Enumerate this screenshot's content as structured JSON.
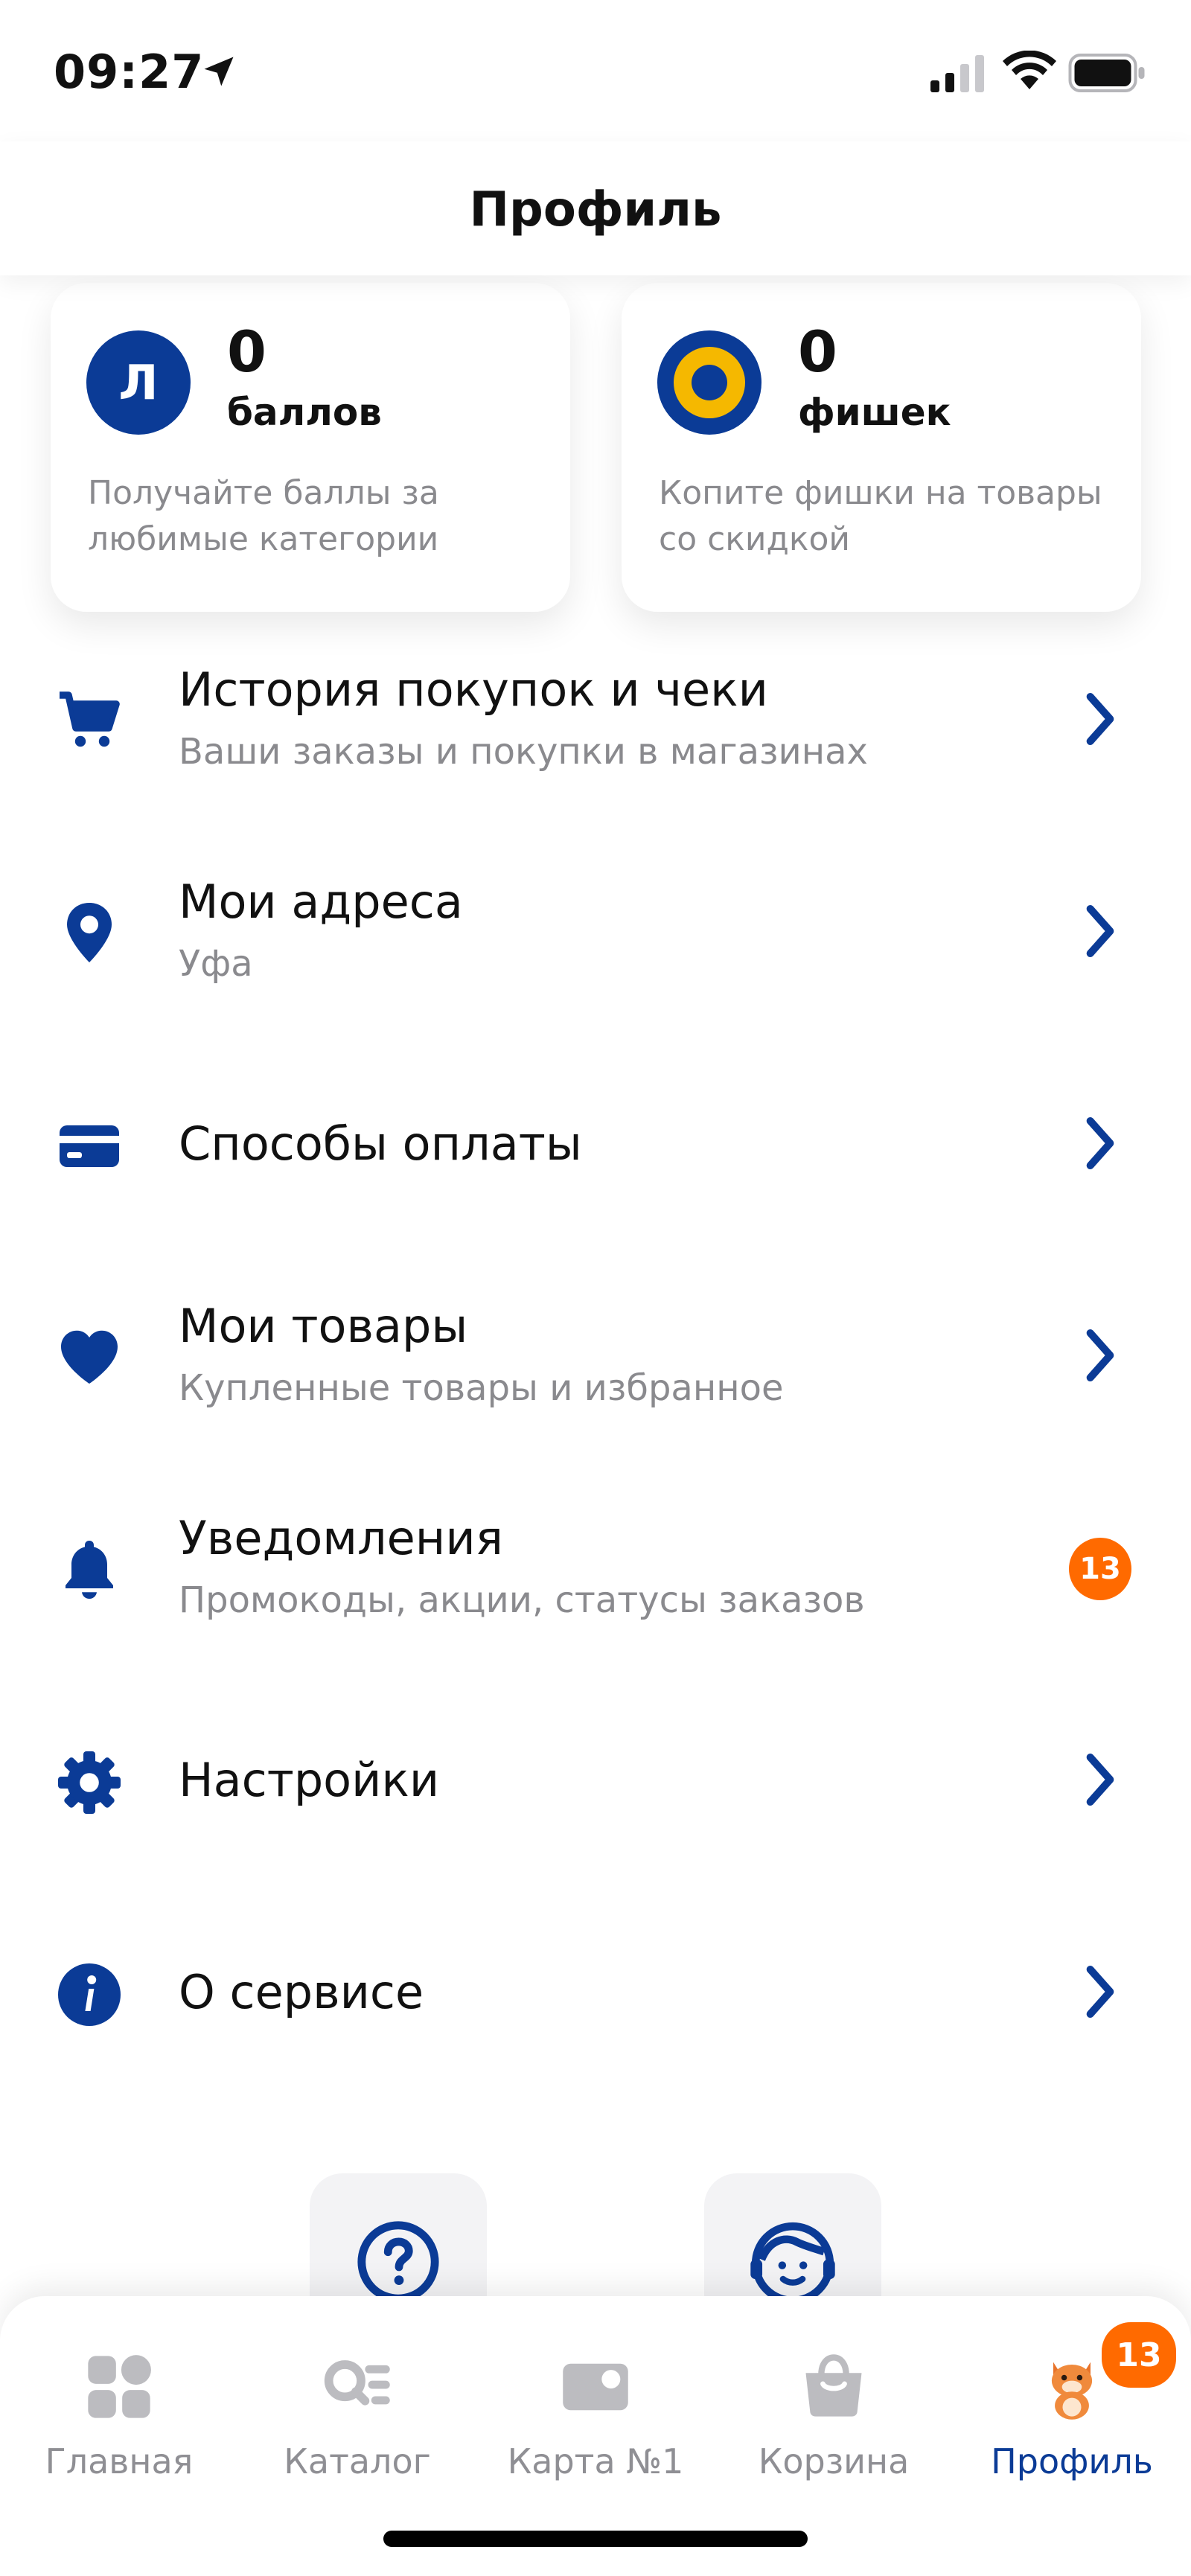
{
  "status_bar": {
    "time": "09:27"
  },
  "header": {
    "title": "Профиль"
  },
  "cards": [
    {
      "value": "0",
      "unit": "баллов",
      "description": "Получайте баллы за любимые категории",
      "icon": "points-icon",
      "icon_letter": "Л"
    },
    {
      "value": "0",
      "unit": "фишек",
      "description": "Копите фишки на товары со скидкой",
      "icon": "chips-icon"
    }
  ],
  "menu": [
    {
      "title": "История покупок и чеки",
      "subtitle": "Ваши заказы и покупки в магазинах",
      "icon": "cart-icon"
    },
    {
      "title": "Мои адреса",
      "subtitle": "Уфа",
      "icon": "location-pin-icon"
    },
    {
      "title": "Способы оплаты",
      "subtitle": "",
      "icon": "credit-card-icon"
    },
    {
      "title": "Мои товары",
      "subtitle": "Купленные товары и избранное",
      "icon": "heart-icon"
    },
    {
      "title": "Уведомления",
      "subtitle": "Промокоды, акции, статусы заказов",
      "icon": "bell-icon",
      "badge": "13"
    },
    {
      "title": "Настройки",
      "subtitle": "",
      "icon": "gear-icon"
    },
    {
      "title": "О сервисе",
      "subtitle": "",
      "icon": "info-icon"
    }
  ],
  "help_buttons": [
    {
      "icon": "question-icon"
    },
    {
      "icon": "support-agent-icon"
    }
  ],
  "tabs": [
    {
      "label": "Главная",
      "icon": "home-grid-icon",
      "active": false
    },
    {
      "label": "Каталог",
      "icon": "catalog-search-icon",
      "active": false
    },
    {
      "label": "Карта №1",
      "icon": "loyalty-card-icon",
      "active": false
    },
    {
      "label": "Корзина",
      "icon": "basket-icon",
      "active": false
    },
    {
      "label": "Профиль",
      "icon": "cat-mascot-icon",
      "active": true,
      "badge": "13"
    }
  ],
  "colors": {
    "brand_blue": "#0b3b96",
    "accent_yellow": "#f5b800",
    "badge_orange": "#ff6a00",
    "muted_text": "#8a8a8e",
    "inactive_tab": "#b9b9bd"
  }
}
